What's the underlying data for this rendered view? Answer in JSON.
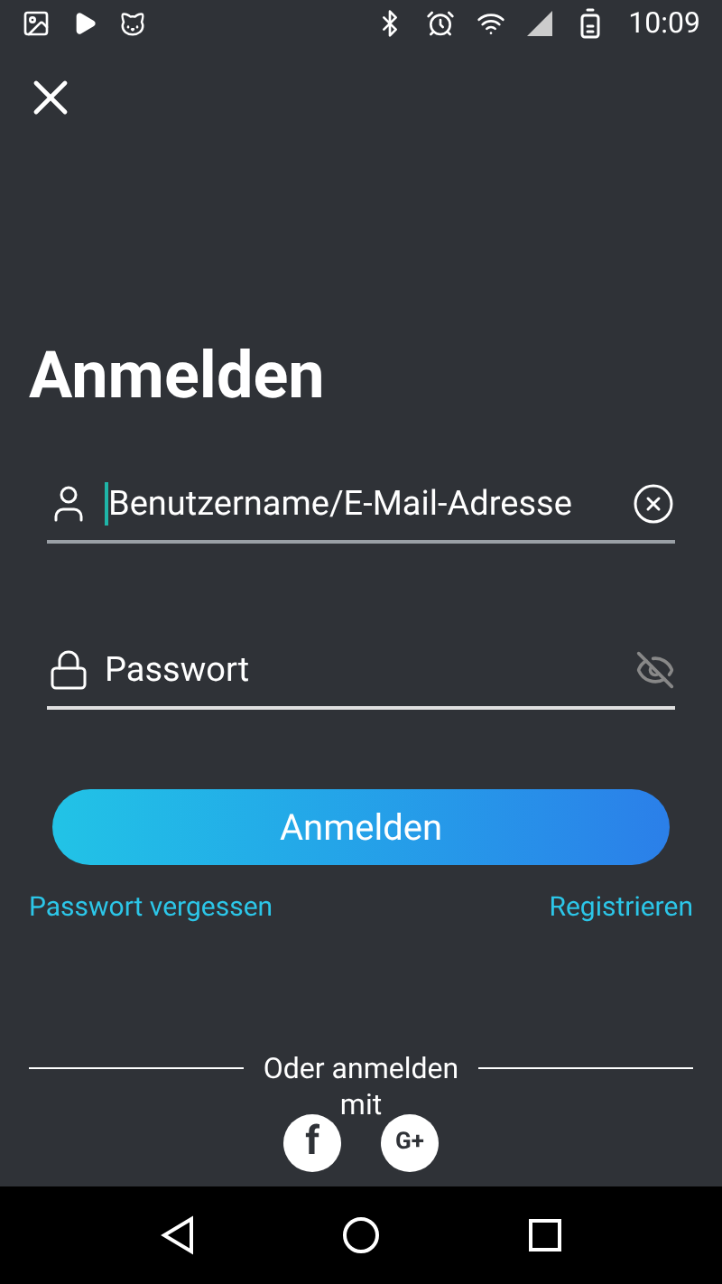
{
  "status_bar": {
    "time": "10:09"
  },
  "title": "Anmelden",
  "fields": [
    {
      "kind": "username",
      "placeholder": "Benutzername/E-Mail-Adresse",
      "focused": true
    },
    {
      "kind": "password",
      "placeholder": "Passwort",
      "focused": false
    }
  ],
  "submit_button": "Anmelden",
  "links": [
    "Passwort vergessen",
    "Registrieren"
  ],
  "divider_text": "Oder anmelden mit",
  "social_buttons": [
    {
      "kind": "facebook",
      "label": "f"
    },
    {
      "kind": "google",
      "label": "G+"
    }
  ]
}
